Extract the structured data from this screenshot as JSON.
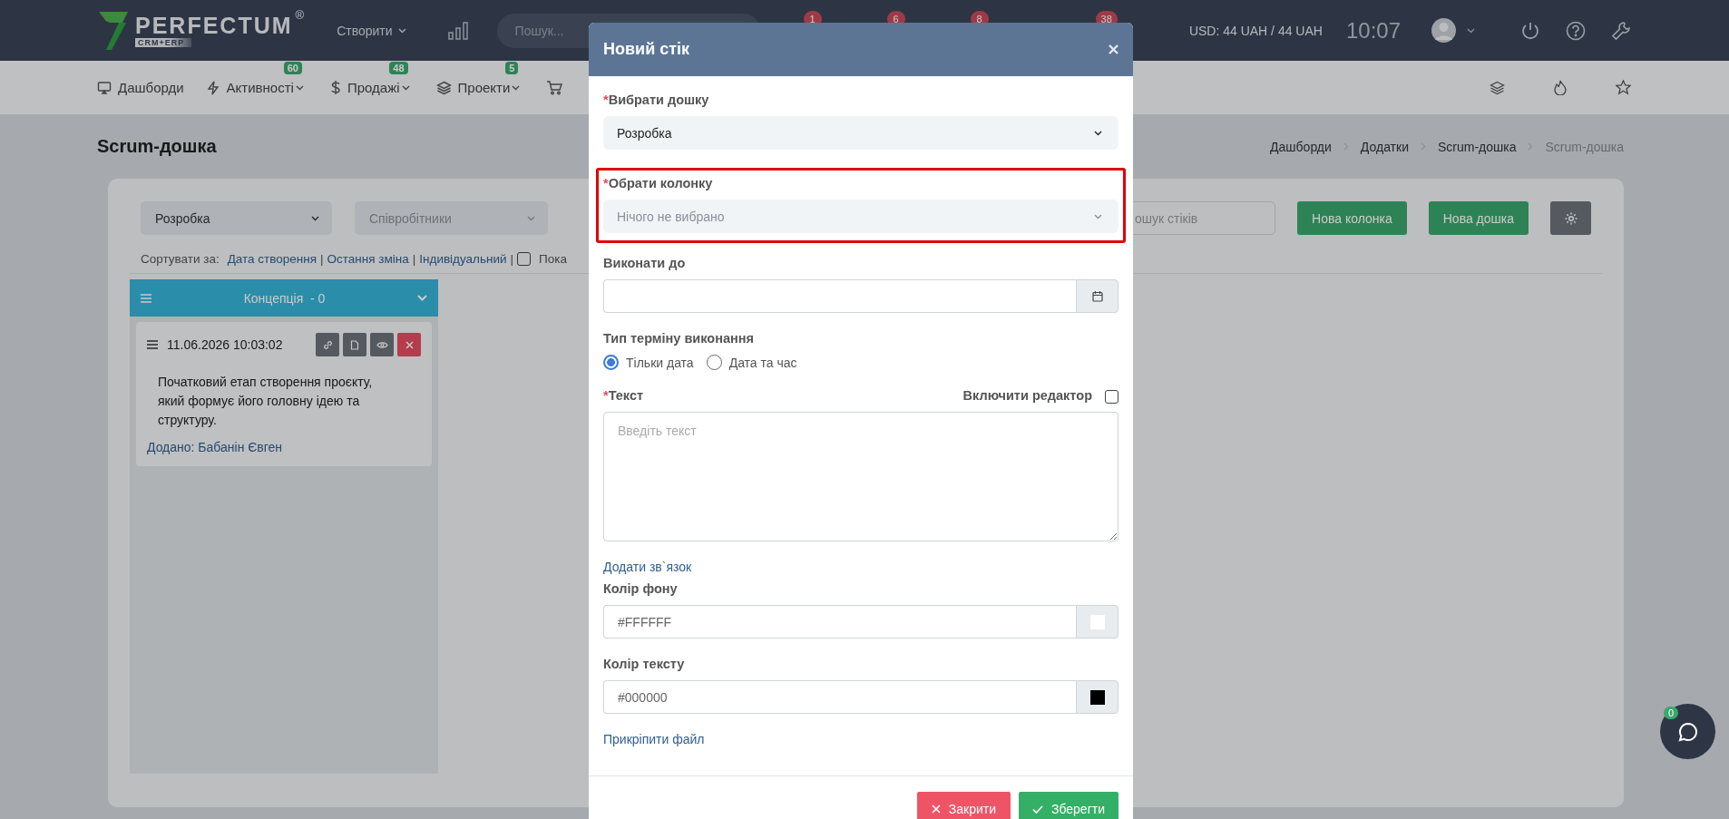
{
  "top_bar": {
    "logo": {
      "name": "PERFECTUM",
      "mark": "®",
      "tagline": "CRM+ERP"
    },
    "create_menu": "Створити",
    "search": {
      "placeholder": "Пошук..."
    },
    "badges": [
      "1",
      "6",
      "8",
      "38"
    ],
    "currency": "USD: 44 UAH / 44 UAH",
    "time": "10:07"
  },
  "nav": [
    {
      "label": "Дашборди"
    },
    {
      "label": "Активності",
      "badge": "60"
    },
    {
      "label": "Продажі",
      "badge": "48"
    },
    {
      "label": "Проекти",
      "badge": "5"
    }
  ],
  "page": {
    "title": "Scrum-дошка",
    "breadcrumbs": [
      {
        "label": "Дашборди",
        "current": false
      },
      {
        "label": "Додатки",
        "current": false
      },
      {
        "label": "Scrum-дошка",
        "current": false
      },
      {
        "label": "Scrum-дошка",
        "current": true
      }
    ]
  },
  "board": {
    "board_select": "Розробка",
    "employees_select": {
      "placeholder": "Співробітники"
    },
    "search": {
      "placeholder": "ошук стіків"
    },
    "buttons": [
      "Нова колонка",
      "Нова дошка"
    ],
    "sort": {
      "label": "Сортувати за:",
      "options": [
        "Дата створення",
        "Остання зміна",
        "Індивідуальний"
      ],
      "separator": "|",
      "checkbox": {
        "checked": false,
        "label": "Пока"
      }
    },
    "columns": [
      {
        "title": "Концепція  - 0",
        "cards": [
          {
            "date": "11.06.2026 10:03:02",
            "text": "Початковий етап створення проєкту, який формує його головну ідею та структуру.",
            "author": "Додано: Бабанін Євген"
          }
        ]
      }
    ]
  },
  "modal": {
    "title": "Новий стік",
    "fields": [
      {
        "kind": "select",
        "label": "Вибрати дошку",
        "required_mark": "*",
        "value": "Розробка",
        "highlighted": false
      },
      {
        "kind": "select",
        "label": "Обрати колонку",
        "required_mark": "*",
        "placeholder": "Нічого не вибрано",
        "highlighted": true
      },
      {
        "kind": "date",
        "label": "Виконати до"
      },
      {
        "kind": "radio",
        "label": "Тип терміну виконання",
        "options": [
          {
            "label": "Тільки дата",
            "selected": true
          },
          {
            "label": "Дата та час",
            "selected": false
          }
        ]
      },
      {
        "kind": "textarea",
        "label": "Текст",
        "required_mark": "*",
        "placeholder": "Введіть текст",
        "toggle": {
          "label": "Включити редактор",
          "checked": false
        }
      },
      {
        "kind": "link",
        "label": "Додати зв`язок"
      },
      {
        "kind": "color",
        "label": "Колір фону",
        "value": "#FFFFFF",
        "color": "#ffffff"
      },
      {
        "kind": "color",
        "label": "Колір тексту",
        "value": "#000000",
        "color": "#000000"
      },
      {
        "kind": "link",
        "label": "Прикріпити файл"
      }
    ],
    "buttons": [
      {
        "kind": "cancel",
        "label": "Закрити"
      },
      {
        "kind": "save",
        "label": "Зберегти"
      }
    ]
  },
  "chat": {
    "badge": "0"
  }
}
